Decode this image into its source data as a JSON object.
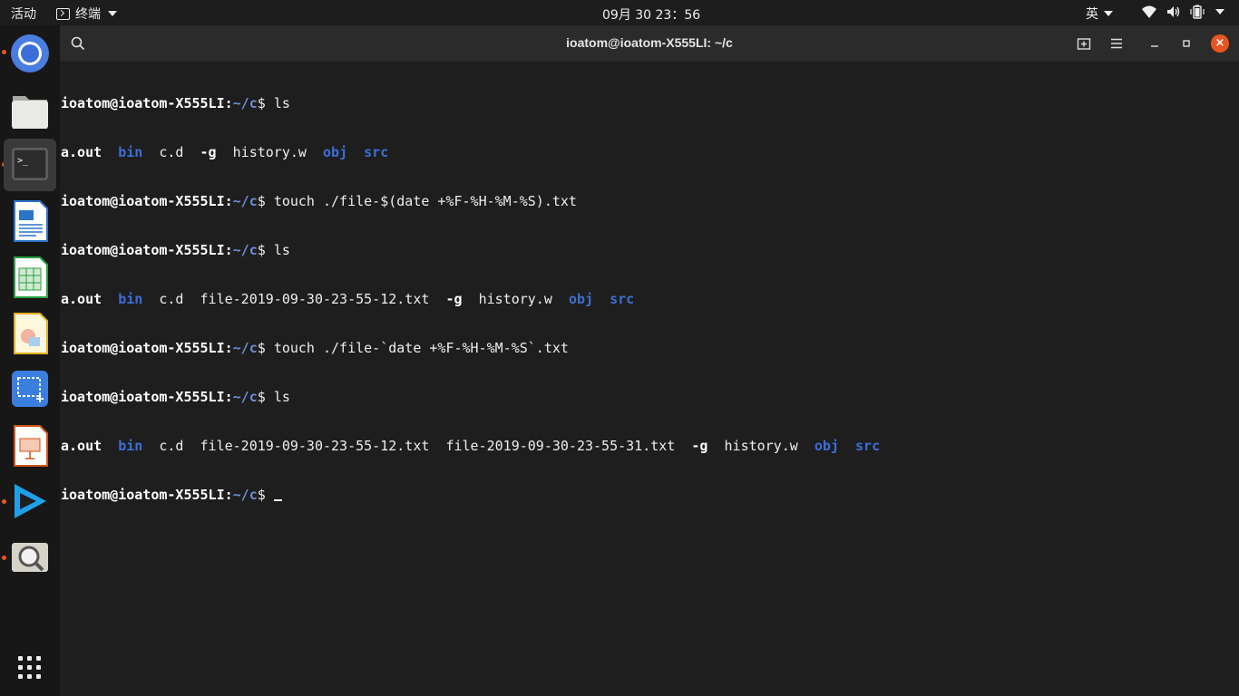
{
  "topbar": {
    "activities": "活动",
    "app_name": "终端",
    "clock": "09月 30 23：56",
    "input_method": "英"
  },
  "dock": {
    "items": [
      "chrome-icon",
      "files-icon",
      "terminal-icon",
      "writer-icon",
      "calc-icon",
      "draw-icon",
      "screenshot-icon",
      "impress-icon",
      "media-player-icon",
      "image-viewer-icon",
      "show-apps-icon"
    ]
  },
  "window": {
    "title": "ioatom@ioatom-X555LI: ~/c"
  },
  "prompt": {
    "user_host": "ioatom@ioatom-X555LI",
    "colon": ":",
    "path": "~/c",
    "dollar": "$ "
  },
  "terminal": {
    "cmd1": "ls",
    "out1": {
      "a": "a.out",
      "b": "bin",
      "c": "c.d",
      "g": "-g",
      "h": "history.w",
      "o": "obj",
      "s": "src"
    },
    "cmd2": "touch ./file-$(date +%F-%H-%M-%S).txt",
    "cmd3": "ls",
    "out3": {
      "a": "a.out",
      "b": "bin",
      "c": "c.d",
      "f1": "file-2019-09-30-23-55-12.txt",
      "g": "-g",
      "h": "history.w",
      "o": "obj",
      "s": "src"
    },
    "cmd4": "touch ./file-`date +%F-%H-%M-%S`.txt",
    "cmd5": "ls",
    "out5": {
      "a": "a.out",
      "b": "bin",
      "c": "c.d",
      "f1": "file-2019-09-30-23-55-12.txt",
      "f2": "file-2019-09-30-23-55-31.txt",
      "g": "-g",
      "h": "history.w",
      "o": "obj",
      "s": "src"
    }
  },
  "colors": {
    "accent": "#e95420",
    "dir": "#3d6ed6",
    "prompt_path": "#6d8ed6"
  }
}
